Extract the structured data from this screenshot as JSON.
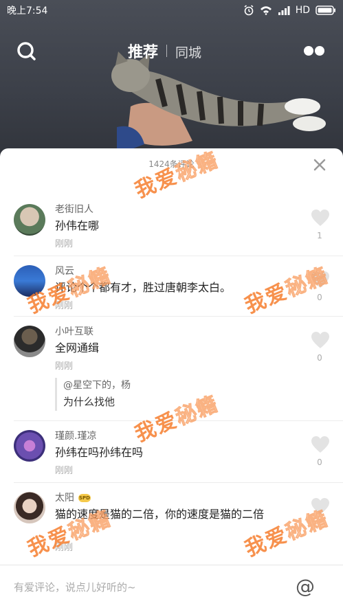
{
  "status_bar": {
    "time": "晚上7:54",
    "network": "HD"
  },
  "top_nav": {
    "tab_recommend": "推荐",
    "tab_city": "同城"
  },
  "sheet": {
    "comment_count": "1424条评论"
  },
  "comments": [
    {
      "name": "老街旧人",
      "text": "孙伟在哪",
      "time": "刚刚",
      "likes": "1"
    },
    {
      "name": "风云",
      "text": "评论个个都有才，胜过唐朝李太白。",
      "time": "刚刚",
      "likes": "0"
    },
    {
      "name": "小叶互联",
      "text": "全网通缉",
      "time": "刚刚",
      "likes": "0",
      "reply": {
        "name": "@星空下的，杨",
        "text": "为什么找他"
      }
    },
    {
      "name": "瑾颜.瑾凉",
      "text": "孙纬在吗孙纬在吗",
      "time": "刚刚",
      "likes": "0"
    },
    {
      "name": "太阳",
      "badge": "SPD",
      "text": "猫的速度是猫的二倍，你的速度是猫的二倍",
      "time": "刚刚",
      "likes": ""
    }
  ],
  "input_bar": {
    "placeholder": "有爱评论，说点儿好听的~",
    "at_symbol": "@"
  },
  "watermark": {
    "part1": "我爱",
    "part2": "秘籍"
  },
  "colors": {
    "accent": "#f67e2e",
    "like_gray": "#e3e3e3"
  }
}
